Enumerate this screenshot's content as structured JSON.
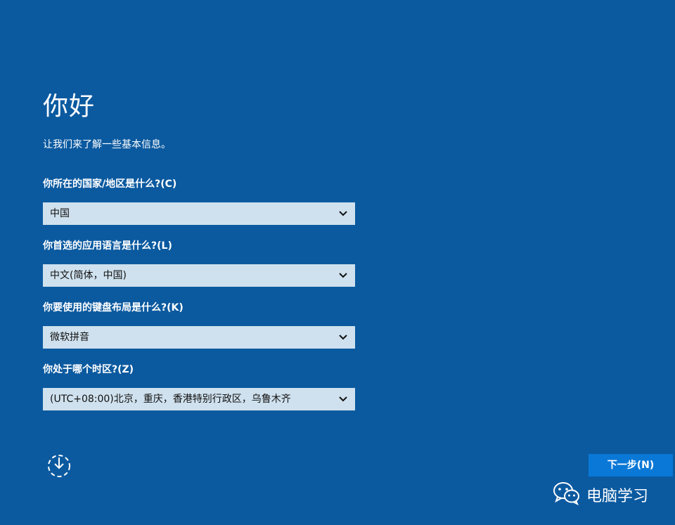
{
  "page": {
    "title": "你好",
    "subtitle": "让我们来了解一些基本信息。"
  },
  "fields": [
    {
      "label": "你所在的国家/地区是什么?(C)",
      "value": "中国"
    },
    {
      "label": "你首选的应用语言是什么?(L)",
      "value": "中文(简体，中国)"
    },
    {
      "label": "你要使用的键盘布局是什么?(K)",
      "value": "微软拼音"
    },
    {
      "label": "你处于哪个时区?(Z)",
      "value": "(UTC+08:00)北京，重庆，香港特别行政区，乌鲁木齐"
    }
  ],
  "footer": {
    "ease_of_access_icon": "ease-of-access-icon",
    "next_label": "下一步(N)"
  },
  "watermark": {
    "icon": "wechat-icon",
    "text": "电脑学习"
  },
  "colors": {
    "background": "#0b5aa0",
    "select_bg": "#cfe1ee",
    "next_button": "#0a78d7"
  }
}
